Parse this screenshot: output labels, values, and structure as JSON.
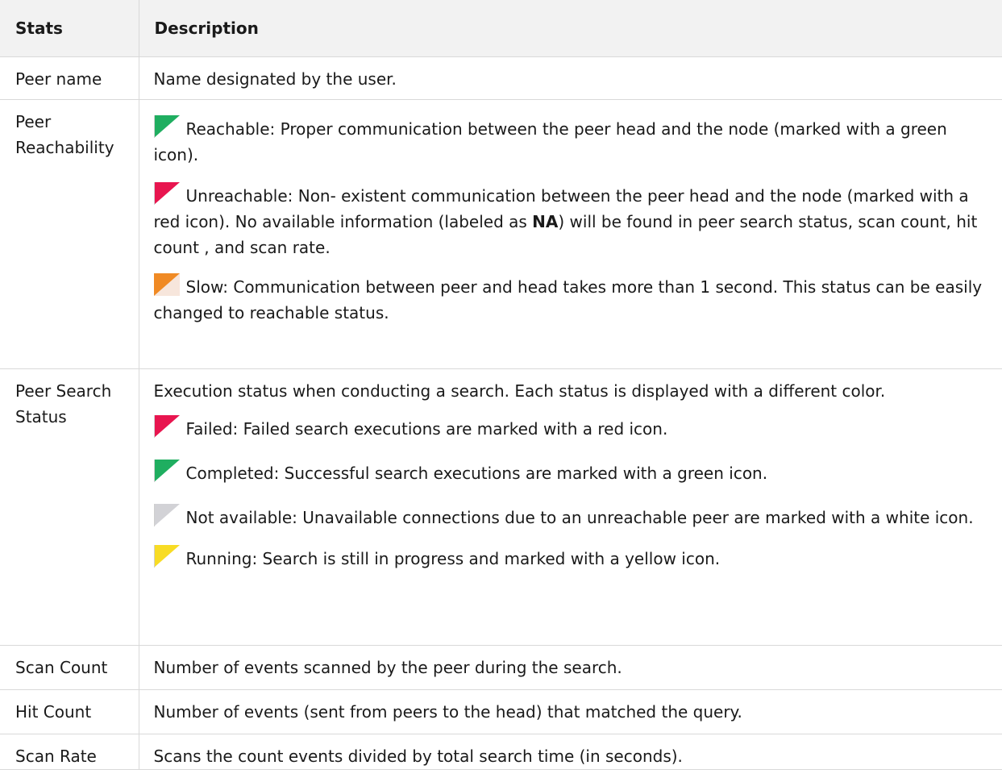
{
  "header": {
    "stats": "Stats",
    "description": "Description"
  },
  "rows": {
    "peer_name": {
      "stat": "Peer name",
      "desc": "Name designated by the user."
    },
    "reachability": {
      "stat": "Peer Reachability",
      "reachable": "Reachable: Proper communication between the peer head and the node (marked with a green icon).",
      "unreachable_pre": "Unreachable: Non- existent communication between the peer head and the node (marked with a red icon). No available information (labeled as ",
      "unreachable_bold": "NA",
      "unreachable_post": ") will be found in peer search status, scan count, hit count , and scan rate.",
      "slow": "Slow: Communication between peer and head takes more than 1 second. This status can be easily changed to reachable status."
    },
    "search_status": {
      "stat": "Peer Search Status",
      "intro": "Execution status when conducting a search. Each status is displayed with a different color.",
      "failed": "Failed: Failed search executions are marked with a red icon.",
      "completed": "Completed: Successful search executions are marked with a green icon.",
      "not_available": "Not available: Unavailable connections due to an unreachable peer are marked with a white icon.",
      "running": "Running: Search is still in progress and marked with a yellow icon."
    },
    "scan_count": {
      "stat": "Scan Count",
      "desc": "Number of events scanned by the peer during the search."
    },
    "hit_count": {
      "stat": "Hit Count",
      "desc": "Number of events (sent from peers to the head) that matched the query."
    },
    "scan_rate": {
      "stat": "Scan Rate",
      "desc": "Scans the count events divided by total search time (in seconds)."
    }
  },
  "icons": {
    "green": "#1fae60",
    "red": "#e8154f",
    "orange": "#f08a24",
    "gray": "#d2d2d6",
    "yellow": "#f8dc24"
  }
}
